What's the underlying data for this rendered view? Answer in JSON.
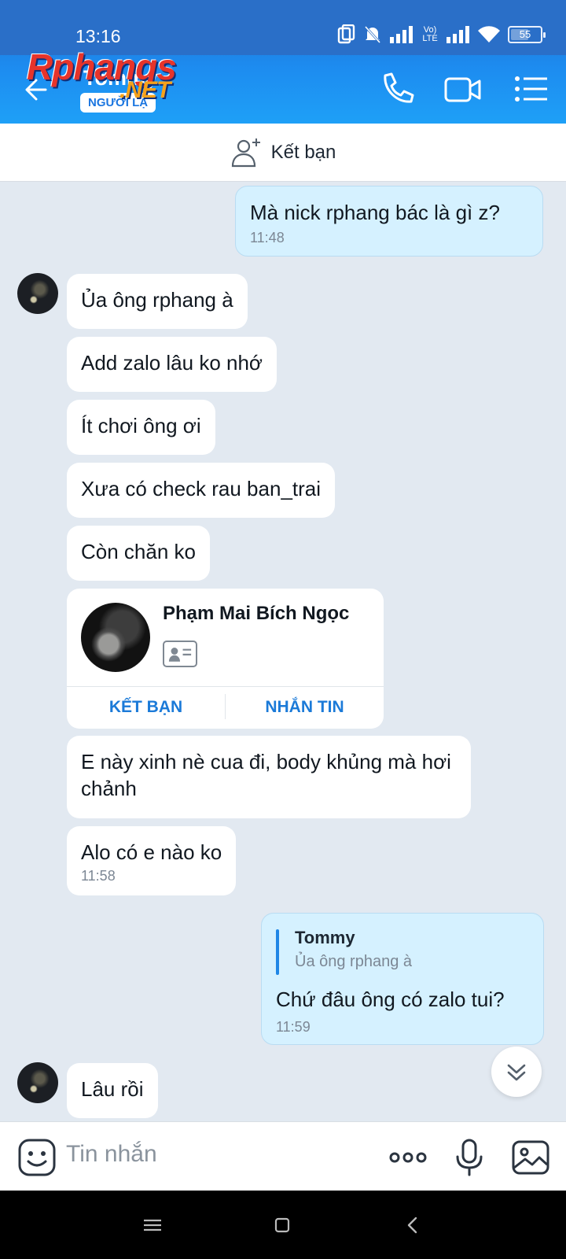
{
  "status": {
    "time": "13:16",
    "battery": "55",
    "network": "Vo) LTE"
  },
  "header": {
    "contact_name": "Tommy",
    "contact_tag": "NGƯỜI LẠ",
    "watermark": "Rphangs",
    "watermark_suffix": ".NET"
  },
  "friend_bar": {
    "label": "Kết bạn"
  },
  "messages": [
    {
      "side": "out",
      "text": "Mà nick rphang bác là gì z?",
      "time": "11:48"
    },
    {
      "side": "in",
      "text": "Ủa ông rphang à"
    },
    {
      "side": "in",
      "text": "Add zalo lâu ko nhớ"
    },
    {
      "side": "in",
      "text": "Ít chơi ông ơi"
    },
    {
      "side": "in",
      "text": "Xưa có check rau ban_trai"
    },
    {
      "side": "in",
      "text": "Còn chăn ko"
    },
    {
      "side": "in",
      "text": "E này xinh nè cua đi, body khủng mà hơi chảnh"
    },
    {
      "side": "in",
      "text": "Alo có e nào ko",
      "time": "11:58"
    },
    {
      "side": "in",
      "text": "Lâu rồi"
    }
  ],
  "contact_card": {
    "name": "Phạm Mai Bích Ngọc",
    "add_friend": "KẾT BẠN",
    "message": "NHẮN TIN"
  },
  "reply": {
    "quoted_name": "Tommy",
    "quoted_text": "Ủa ông rphang à",
    "text": "Chứ đâu ông có zalo tui?",
    "time": "11:59"
  },
  "composer": {
    "placeholder": "Tin nhắn"
  },
  "icons": [
    "back-arrow-icon",
    "phone-icon",
    "video-icon",
    "menu-icon",
    "add-friend-icon",
    "emoji-icon",
    "more-icon",
    "mic-icon",
    "image-icon"
  ],
  "colors": {
    "header": "#1d8cf0",
    "outgoing_bubble": "#d5f1ff",
    "incoming_bubble": "#ffffff",
    "chat_bg": "#e2e9f1",
    "link_blue": "#1b7ad8"
  }
}
